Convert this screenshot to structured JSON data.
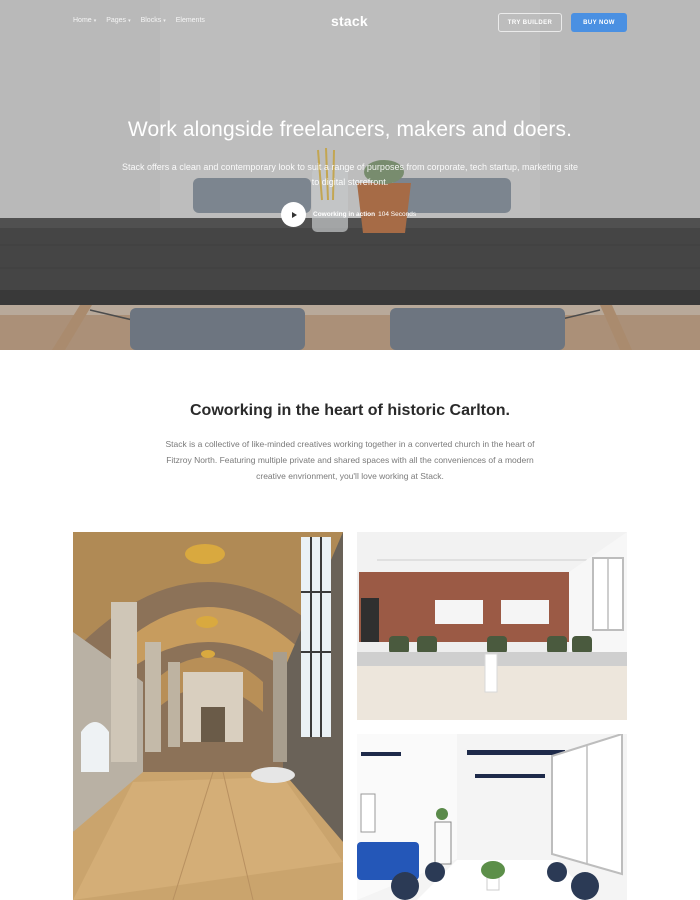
{
  "nav": {
    "links": [
      "Home",
      "Pages",
      "Blocks",
      "Elements"
    ],
    "logo": "stack",
    "try_builder": "TRY BUILDER",
    "buy_now": "BUY NOW"
  },
  "hero": {
    "title": "Work alongside freelancers, makers and doers.",
    "subtitle": "Stack offers a clean and contemporary look to suit a range of purposes from corporate, tech startup, marketing site to digital storefront.",
    "video_label": "Coworking in action",
    "video_duration": "104 Seconds"
  },
  "section": {
    "title": "Coworking in the heart of historic Carlton.",
    "text": "Stack is a collective of like-minded creatives working together in a converted church in the heart of Fitzroy North. Featuring multiple private and shared spaces with all the conveniences of a modern creative envrionment, you'll love working at Stack."
  },
  "colors": {
    "accent": "#4a90e2"
  }
}
